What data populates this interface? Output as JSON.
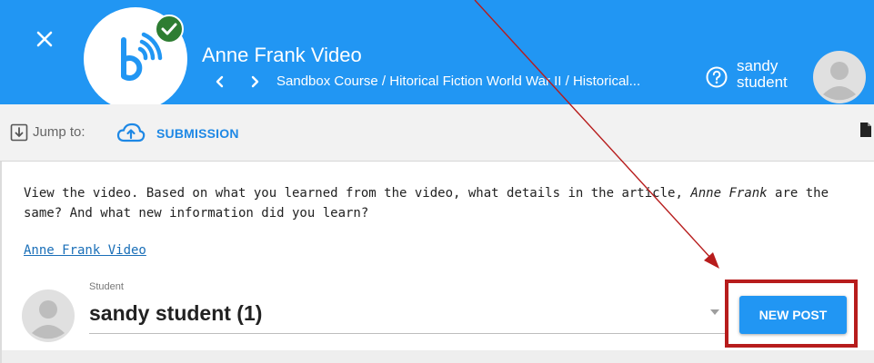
{
  "header": {
    "course_title": "Anne Frank Video",
    "breadcrumb": "Sandbox Course / Hitorical Fiction World War II / Historical...",
    "user_first": "sandy",
    "user_last": "student"
  },
  "jumpbar": {
    "jump_label": "Jump to:",
    "submission_label": "SUBMISSION"
  },
  "content": {
    "prompt_part1": "View the video.  Based on what you learned from the video, what details in the article, ",
    "prompt_italic": "Anne Frank",
    "prompt_part2": " are the same? And what new information did you learn?",
    "video_link": "Anne Frank Video",
    "student_caption": "Student",
    "student_selected": "sandy student (1)",
    "new_post_label": "NEW POST"
  },
  "colors": {
    "header_blue": "#2196f3",
    "accent_blue": "#1e88e5",
    "check_green": "#2e7d32",
    "highlight_red": "#b71c1c"
  },
  "icons": [
    "close-icon",
    "logo-icon",
    "check-icon",
    "chevron-left-icon",
    "chevron-right-icon",
    "help-icon",
    "avatar-icon",
    "jump-icon",
    "cloud-upload-icon",
    "document-icon",
    "dropdown-arrow-icon"
  ]
}
